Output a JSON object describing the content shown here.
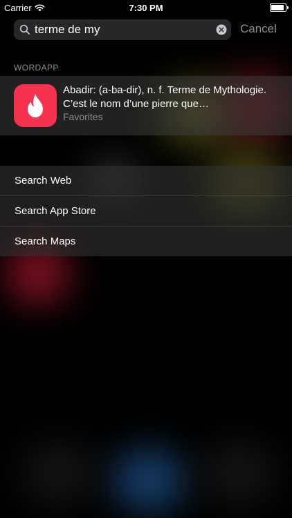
{
  "status_bar": {
    "carrier": "Carrier",
    "time": "7:30 PM",
    "battery_level": 1.0,
    "wifi_icon": "wifi-icon",
    "battery_icon": "battery-icon"
  },
  "search": {
    "query": "terme de my",
    "cancel_label": "Cancel",
    "search_icon": "search-icon",
    "clear_icon": "clear-icon"
  },
  "results": {
    "section_header": "WORDAPP",
    "items": [
      {
        "title": "Abadir: (a-ba-dir), n. f. Terme de Mythologie. C’est le nom d’une pierre que…",
        "subtitle": "Favorites",
        "icon": "flame-icon",
        "icon_color": "#f7324f"
      }
    ]
  },
  "search_options": [
    {
      "label": "Search Web"
    },
    {
      "label": "Search App Store"
    },
    {
      "label": "Search Maps"
    }
  ]
}
